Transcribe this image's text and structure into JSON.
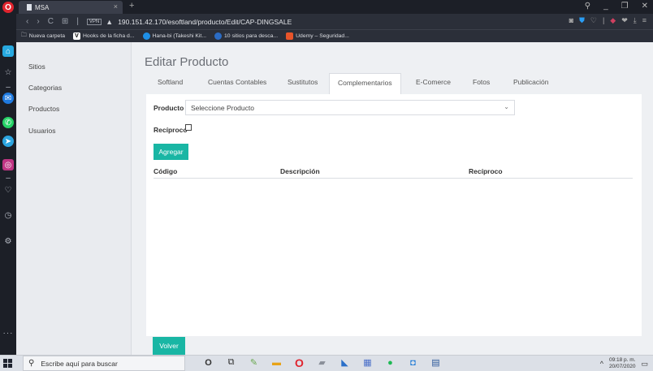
{
  "browser": {
    "tab_title": "MSA",
    "tab_close": "×",
    "new_tab": "+",
    "url": "190.151.42.170/esoftland/producto/Edit/CAP-DINGSALE",
    "vpn_label": "VPN",
    "bookmarks": [
      {
        "label": "Nueva carpeta",
        "color": "#2b2f39"
      },
      {
        "label": "Hooks de la ficha d...",
        "color": "#ffffff"
      },
      {
        "label": "Hana-bi (Takeshi Kit...",
        "color": "#1e8fe6"
      },
      {
        "label": "10 sitios para desca...",
        "color": "#2b6cc4"
      },
      {
        "label": "Udemy – Seguridad...",
        "color": "#e8542a"
      }
    ]
  },
  "sidebar": {
    "items": [
      {
        "label": "Sitios"
      },
      {
        "label": "Categorias"
      },
      {
        "label": "Productos"
      },
      {
        "label": "Usuarios"
      }
    ]
  },
  "main": {
    "title": "Editar Producto",
    "tabs": [
      {
        "label": "Softland"
      },
      {
        "label": "Cuentas Contables"
      },
      {
        "label": "Sustitutos"
      },
      {
        "label": "Complementarios",
        "active": true
      },
      {
        "label": "E-Comerce"
      },
      {
        "label": "Fotos"
      },
      {
        "label": "Publicación"
      }
    ],
    "producto_label": "Producto",
    "producto_select_value": "Seleccione Producto",
    "reciproco_label": "Recíproco",
    "reciproco_checked": false,
    "agregar_button": "Agregar",
    "table_headers": [
      "Código",
      "Descripción",
      "Recíproco"
    ],
    "volver_button": "Volver"
  },
  "taskbar": {
    "search_placeholder": "Escribe aquí para buscar",
    "time": "09:18 p. m.",
    "date": "20/07/2020"
  },
  "colors": {
    "accent": "#19b6a4",
    "browser_dark": "#1c1f27"
  }
}
